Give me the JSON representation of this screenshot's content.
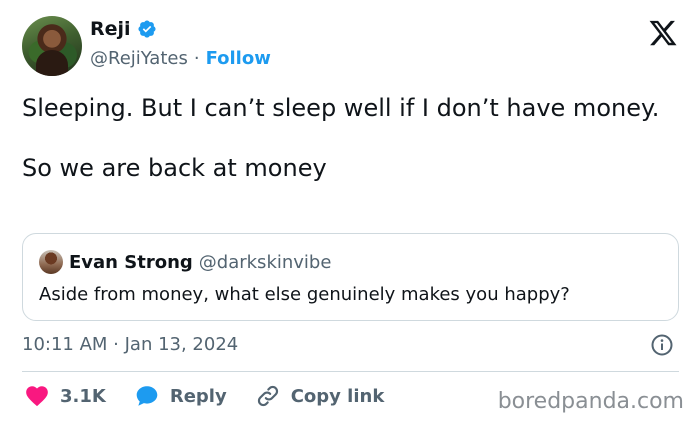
{
  "author": {
    "display_name": "Reji",
    "handle": "@RejiYates",
    "separator": "·",
    "follow_label": "Follow"
  },
  "tweet": {
    "lines": [
      "Sleeping. But I can’t sleep well if I don’t have money.",
      "So we are back at money"
    ]
  },
  "quoted_tweet": {
    "display_name": "Evan Strong",
    "handle": "@darkskinvibe",
    "text": "Aside from money, what else genuinely makes you happy?"
  },
  "timestamp": "10:11 AM · Jan 13, 2024",
  "actions": {
    "likes": "3.1K",
    "reply_label": "Reply",
    "copy_link_label": "Copy link"
  },
  "watermark": "boredpanda.com",
  "colors": {
    "accent": "#1d9bf0",
    "like": "#f91880",
    "muted": "#536471",
    "text": "#0f1419",
    "border": "#cfd9de"
  },
  "icons": {
    "brand": "x-logo-icon",
    "verified": "verified-badge-icon",
    "info": "info-icon",
    "like": "heart-icon",
    "reply": "speech-bubble-icon",
    "copy": "link-icon"
  }
}
